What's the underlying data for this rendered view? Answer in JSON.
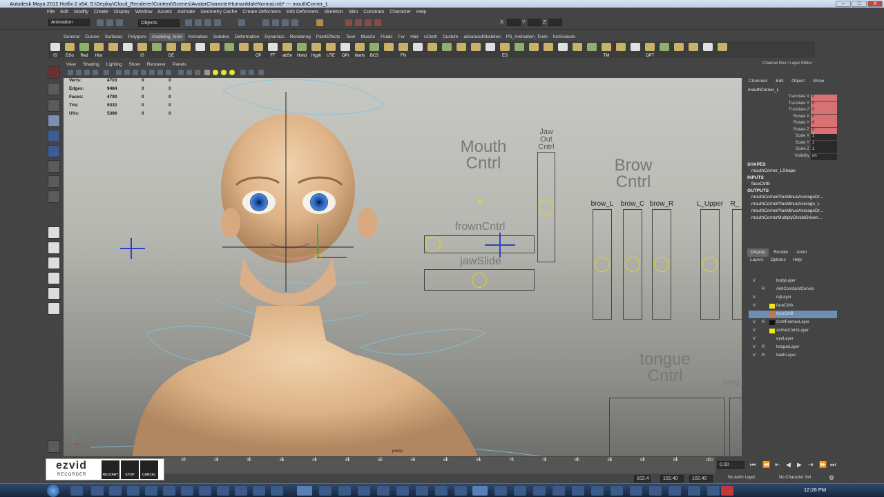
{
  "window": {
    "title": "Autodesk Maya 2012 Hotfix 2 x64: S:\\Deploy\\Cloud_Renderer\\Content\\Scenes\\AvatarCharacterHumanMaleNormal.mb*  ---  mouthCorner_L",
    "min": "–",
    "max": "□",
    "close": "X"
  },
  "menu": [
    "File",
    "Edit",
    "Modify",
    "Create",
    "Display",
    "Window",
    "Assets",
    "Animate",
    "Geometry Cache",
    "Create Deformers",
    "Edit Deformers",
    "Skeleton",
    "Skin",
    "Constrain",
    "Character",
    "Help"
  ],
  "status": {
    "mode": "Animation",
    "selection_field": "Objects",
    "x_label": "X:",
    "y_label": "Y:",
    "z_label": "Z:"
  },
  "shelf_tabs": [
    "General",
    "Curves",
    "Surfaces",
    "Polygons",
    "modeling_tools",
    "Animation",
    "Subdivs",
    "Deformation",
    "Dynamics",
    "Rendering",
    "PaintEffects",
    "Toon",
    "Muscle",
    "Fluids",
    "Fur",
    "Hair",
    "nCloth",
    "Custom",
    "advancedSkeleton",
    "PS_Animation_Tools",
    "funSockets"
  ],
  "shelf_active": "modeling_tools",
  "shelf_icons": [
    "IS",
    "DSo",
    "Red",
    "Hist",
    "",
    "",
    "IS",
    "",
    "DE",
    "",
    "",
    "",
    "",
    "",
    "CP",
    "FT",
    "abSn",
    "Hshd",
    "Hgph",
    "UTE",
    "OPt",
    "hiarls",
    "BCS",
    "",
    "FN",
    "",
    "",
    "",
    "",
    "",
    "",
    "ES",
    "",
    "",
    "",
    "",
    "",
    "",
    "TM",
    "",
    "",
    "OPT",
    "",
    "",
    "",
    "",
    ""
  ],
  "panel_menu": [
    "View",
    "Shading",
    "Lighting",
    "Show",
    "Renderer",
    "Panels"
  ],
  "hud": {
    "rows": [
      {
        "label": "Verts:",
        "v1": "4703",
        "v2": "0",
        "v3": "0"
      },
      {
        "label": "Edges:",
        "v1": "9484",
        "v2": "0",
        "v3": "0"
      },
      {
        "label": "Faces:",
        "v1": "4790",
        "v2": "0",
        "v3": "0"
      },
      {
        "label": "Tris:",
        "v1": "9332",
        "v2": "0",
        "v3": "0"
      },
      {
        "label": "UVs:",
        "v1": "5386",
        "v2": "0",
        "v3": "0"
      }
    ]
  },
  "viewport": {
    "mouth_cntrl": "Mouth\nCntrl",
    "jaw_out_cntrl": "Jaw\nOut\nCntrl",
    "brow_cntrl": "Brow\nCntrl",
    "frown_cntrl": "frownCntrl",
    "jaw_slide": "jawSlide",
    "brow_l": "brow_L",
    "brow_c": "brow_C",
    "brow_r": "brow_R",
    "l_upper": "L_Upper",
    "r_upper": "R_",
    "tongue_cntrl": "tongue\nCntrl",
    "tongue_partial": "tong",
    "camera": "persp"
  },
  "channel_box": {
    "title": "Channel Box / Layer Editor",
    "menu": [
      "Channels",
      "Edit",
      "Object",
      "Show"
    ],
    "object": "mouthCorner_L",
    "attributes": [
      {
        "name": "Translate X",
        "value": "0",
        "keyed": true
      },
      {
        "name": "Translate Y",
        "value": "0",
        "keyed": true
      },
      {
        "name": "Translate Z",
        "value": "0",
        "keyed": true
      },
      {
        "name": "Rotate X",
        "value": "0",
        "keyed": true
      },
      {
        "name": "Rotate Y",
        "value": "0",
        "keyed": true
      },
      {
        "name": "Rotate Z",
        "value": "0",
        "keyed": true
      },
      {
        "name": "Scale X",
        "value": "1",
        "keyed": false
      },
      {
        "name": "Scale Y",
        "value": "1",
        "keyed": false
      },
      {
        "name": "Scale Z",
        "value": "1",
        "keyed": false
      },
      {
        "name": "Visibility",
        "value": "on",
        "keyed": false
      }
    ],
    "shapes_header": "SHAPES",
    "shape": "mouthCorner_LShape",
    "inputs_header": "INPUTS",
    "input": "faceCtrlB",
    "outputs_header": "OUTPUTS",
    "outputs": [
      "mouthCornerPlusMinusAverageDr...",
      "mouthCornerPlusMinusAverage_L",
      "mouthCornerPlusMinusAverageDr...",
      "mouthCornerMultiplyDivideDriven..."
    ]
  },
  "layer_editor": {
    "tabs": [
      "Display",
      "Render",
      "Anim"
    ],
    "active_tab": "Display",
    "menu": [
      "Layers",
      "Options",
      "Help"
    ],
    "layers": [
      {
        "v": "V",
        "r": "",
        "name": "bodyLayer",
        "color": "",
        "selected": false
      },
      {
        "v": "",
        "r": "R",
        "name": "AimConstaintCurves",
        "color": "",
        "selected": false
      },
      {
        "v": "V",
        "r": "",
        "name": "rigLayer",
        "color": "",
        "selected": false
      },
      {
        "v": "V",
        "r": "",
        "name": "faceCtrlA",
        "color": "#f2e80e",
        "selected": false
      },
      {
        "v": "",
        "r": "",
        "name": "faceCtrlB",
        "color": "#c07a4a",
        "selected": true
      },
      {
        "v": "V",
        "r": "R",
        "name": "CntrlFramesLayer",
        "color": "#111111",
        "selected": false
      },
      {
        "v": "V",
        "r": "",
        "name": "ActiveCntrlsLayer",
        "color": "#f2e80e",
        "selected": false
      },
      {
        "v": "V",
        "r": "",
        "name": "eyeLayer",
        "color": "",
        "selected": false
      },
      {
        "v": "V",
        "r": "R",
        "name": "tongueLayer",
        "color": "",
        "selected": false
      },
      {
        "v": "V",
        "r": "R",
        "name": "teethLayer",
        "color": "",
        "selected": false
      }
    ]
  },
  "timeline": {
    "ticks": [
      "20",
      "25",
      "30",
      "35",
      "40",
      "45",
      "50",
      "55",
      "60",
      "65",
      "70",
      "75",
      "80",
      "85",
      "90",
      "95",
      "100"
    ],
    "current_time": "0.00"
  },
  "range": {
    "start": "102.4",
    "end1": "102.40",
    "end2": "102.40",
    "anim_layer": "No Anim Layer",
    "char_set": "No Character Set"
  },
  "ezvid": {
    "brand": "ezvid",
    "sub": "RECORDER",
    "restart": "RESTART",
    "stop": "STOP",
    "cancel": "CANCEL"
  },
  "taskbar": {
    "clock": "12:26 PM"
  }
}
